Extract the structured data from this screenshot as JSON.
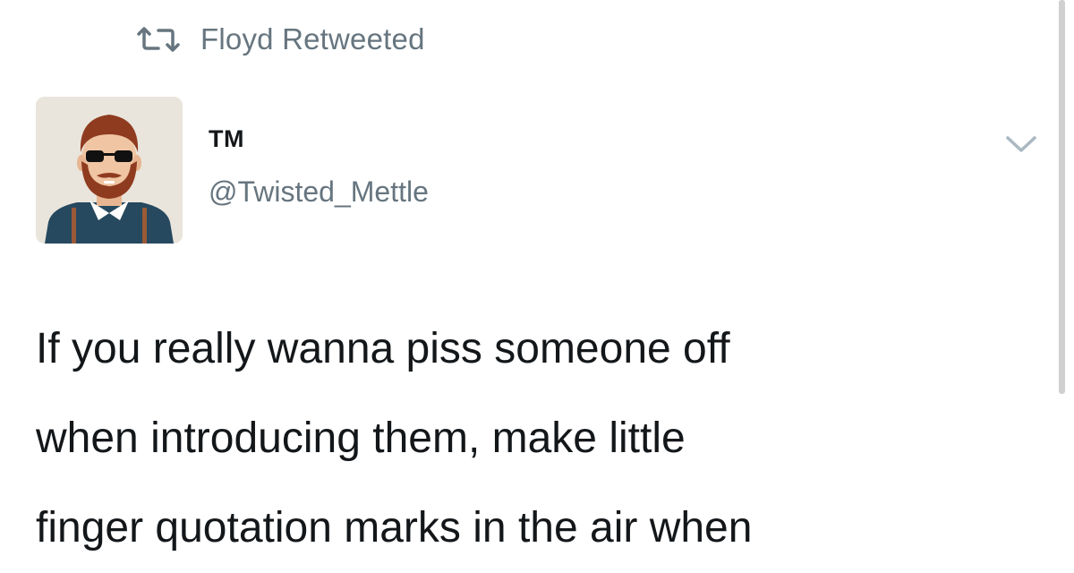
{
  "retweet_header": {
    "icon": "retweet-icon",
    "text": "Floyd Retweeted"
  },
  "author": {
    "avatar": "bearded-man-sunglasses-avatar",
    "display_name": "TM",
    "handle": "@Twisted_Mettle"
  },
  "menu": {
    "icon": "chevron-down-icon"
  },
  "tweet": {
    "lines": [
      "If you really wanna piss someone off",
      "when introducing them, make little",
      "finger quotation marks in the air when"
    ]
  },
  "colors": {
    "text": "#14171a",
    "secondary": "#66757f",
    "background": "#ffffff"
  }
}
